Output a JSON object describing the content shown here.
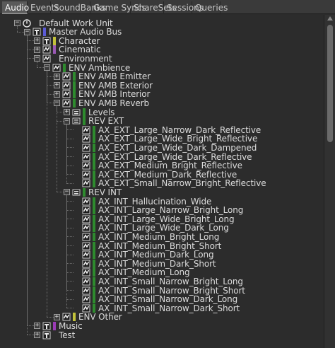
{
  "tabs": [
    {
      "label": "Audio",
      "active": true
    },
    {
      "label": "Events",
      "active": false
    },
    {
      "label": "SoundBanks",
      "active": false
    },
    {
      "label": "Game Syncs",
      "active": false
    },
    {
      "label": "ShareSets",
      "active": false
    },
    {
      "label": "Sessions",
      "active": false
    },
    {
      "label": "Queries",
      "active": false
    }
  ],
  "tree": [
    {
      "label": "Default Work Unit",
      "icon": "work-unit-icon",
      "expanded": true,
      "color": ""
    },
    {
      "label": "Master Audio Bus",
      "icon": "bus-icon",
      "expanded": true,
      "color": "#5b5bd6"
    },
    {
      "label": "Character",
      "icon": "bus-icon",
      "expanded": false,
      "color": "#c2c23a"
    },
    {
      "label": "Cinematic",
      "icon": "aux-bus-icon",
      "expanded": false,
      "color": "#9b59b6"
    },
    {
      "label": "Environment",
      "icon": "aux-bus-icon",
      "expanded": true,
      "color": ""
    },
    {
      "label": "ENV Ambience",
      "icon": "aux-bus-icon",
      "expanded": true,
      "color": "#2e8b2e"
    },
    {
      "label": "ENV AMB Emitter",
      "icon": "aux-bus-icon",
      "expanded": false,
      "color": "#2e8b2e"
    },
    {
      "label": "ENV AMB Exterior",
      "icon": "aux-bus-icon",
      "expanded": false,
      "color": "#2e8b2e"
    },
    {
      "label": "ENV AMB Interior",
      "icon": "aux-bus-icon",
      "expanded": false,
      "color": "#2e8b2e"
    },
    {
      "label": "ENV AMB Reverb",
      "icon": "aux-bus-icon",
      "expanded": true,
      "color": "#2e8b2e"
    },
    {
      "label": "Levels",
      "icon": "folder-icon",
      "expanded": false,
      "color": "#2e8b2e"
    },
    {
      "label": "REV EXT",
      "icon": "folder-icon",
      "expanded": true,
      "color": "#2e8b2e"
    },
    {
      "label": "AX_EXT_Large_Narrow_Dark_Reflective",
      "icon": "aux-bus-icon",
      "expanded": null,
      "color": "#2e8b2e"
    },
    {
      "label": "AX_EXT_Large_Wide_Bright_Reflective",
      "icon": "aux-bus-icon",
      "expanded": null,
      "color": "#2e8b2e"
    },
    {
      "label": "AX_EXT_Large_Wide_Dark_Dampened",
      "icon": "aux-bus-icon",
      "expanded": null,
      "color": "#2e8b2e"
    },
    {
      "label": "AX_EXT_Large_Wide_Dark_Reflective",
      "icon": "aux-bus-icon",
      "expanded": null,
      "color": "#2e8b2e"
    },
    {
      "label": "AX_EXT_Medium_Bright_Reflective",
      "icon": "aux-bus-icon",
      "expanded": null,
      "color": "#2e8b2e"
    },
    {
      "label": "AX_EXT_Medium_Dark_Reflective",
      "icon": "aux-bus-icon",
      "expanded": null,
      "color": "#2e8b2e"
    },
    {
      "label": "AX_EXT_Small_Narrow_Bright_Reflective",
      "icon": "aux-bus-icon",
      "expanded": null,
      "color": "#2e8b2e"
    },
    {
      "label": "REV INT",
      "icon": "folder-icon",
      "expanded": true,
      "color": "#2e8b2e"
    },
    {
      "label": "AX_INT_Hallucination_Wide",
      "icon": "aux-bus-icon",
      "expanded": null,
      "color": "#2e8b2e"
    },
    {
      "label": "AX_INT_Large_Narrow_Bright_Long",
      "icon": "aux-bus-icon",
      "expanded": null,
      "color": "#2e8b2e"
    },
    {
      "label": "AX_INT_Large_Wide_Bright_Long",
      "icon": "aux-bus-icon",
      "expanded": null,
      "color": "#2e8b2e"
    },
    {
      "label": "AX_INT_Large_Wide_Dark_Long",
      "icon": "aux-bus-icon",
      "expanded": null,
      "color": "#2e8b2e"
    },
    {
      "label": "AX_INT_Medium_Bright_Long",
      "icon": "aux-bus-icon",
      "expanded": null,
      "color": "#2e8b2e"
    },
    {
      "label": "AX_INT_Medium_Bright_Short",
      "icon": "aux-bus-icon",
      "expanded": null,
      "color": "#2e8b2e"
    },
    {
      "label": "AX_INT_Medium_Dark_Long",
      "icon": "aux-bus-icon",
      "expanded": null,
      "color": "#2e8b2e"
    },
    {
      "label": "AX_INT_Medium_Dark_Short",
      "icon": "aux-bus-icon",
      "expanded": null,
      "color": "#2e8b2e"
    },
    {
      "label": "AX_INT_Medium_Long",
      "icon": "aux-bus-icon",
      "expanded": null,
      "color": "#2e8b2e"
    },
    {
      "label": "AX_INT_Small_Narrow_Bright_Long",
      "icon": "aux-bus-icon",
      "expanded": null,
      "color": "#2e8b2e"
    },
    {
      "label": "AX_INT_Small_Narrow_Bright_Short",
      "icon": "aux-bus-icon",
      "expanded": null,
      "color": "#2e8b2e"
    },
    {
      "label": "AX_INT_Small_Narrow_Dark_Long",
      "icon": "aux-bus-icon",
      "expanded": null,
      "color": "#2e8b2e"
    },
    {
      "label": "AX_INT_Small_Narrow_Dark_Short",
      "icon": "aux-bus-icon",
      "expanded": null,
      "color": "#2e8b2e"
    },
    {
      "label": "ENV Other",
      "icon": "aux-bus-icon",
      "expanded": false,
      "color": "#c2c23a"
    },
    {
      "label": "Music",
      "icon": "bus-icon",
      "expanded": false,
      "color": "#9b3bb6"
    },
    {
      "label": "Test",
      "icon": "bus-icon",
      "expanded": false,
      "color": ""
    }
  ]
}
